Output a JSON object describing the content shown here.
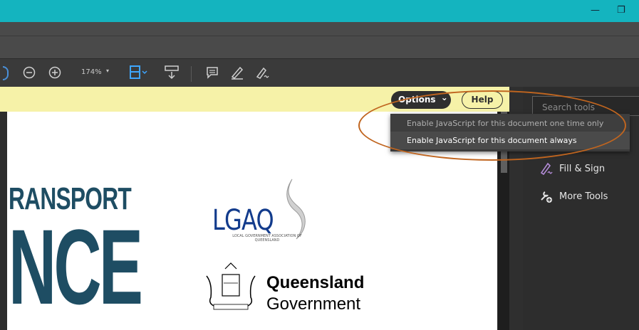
{
  "window": {
    "minimize_glyph": "—",
    "restore_glyph": "❐"
  },
  "toolbar": {
    "zoom_value": "174%",
    "zoom_caret": "▾",
    "icons": [
      "zoom-out-icon",
      "zoom-in-icon",
      "fit-page-icon",
      "scroll-mode-icon",
      "comment-icon",
      "highlight-icon",
      "sign-icon"
    ]
  },
  "javascript_bar": {
    "options_label": "Options",
    "options_caret": "⌄",
    "help_label": "Help",
    "menu": [
      "Enable JavaScript for this document one time only",
      "Enable JavaScript for this document always"
    ]
  },
  "right_pane": {
    "search_placeholder": "Search tools",
    "items": [
      {
        "label": "Fill & Sign",
        "icon": "fill-sign-icon"
      },
      {
        "label": "More Tools",
        "icon": "more-tools-icon"
      }
    ]
  },
  "document": {
    "headline_partial": "RANSPORT",
    "headline_big_partial": "NCE",
    "lgaq_logo": "LGAQ",
    "lgaq_sub": "LOCAL GOVERNMENT ASSOCIATION OF QUEENSLAND",
    "qld_line1": "Queensland",
    "qld_line2": "Government"
  },
  "colors": {
    "titlebar": "#14b4bf",
    "js_bar": "#f6f2a8",
    "highlight_ellipse": "#c0651f",
    "fill_sign_icon": "#b28bd6"
  }
}
